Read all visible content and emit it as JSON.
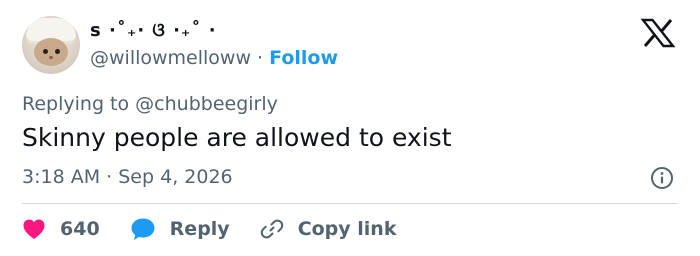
{
  "author": {
    "display_name": "s ·˚₊· ଓ ·₊˚ ·",
    "handle": "@willowmelloww",
    "separator": "·",
    "follow_label": "Follow"
  },
  "reply_context": {
    "prefix": "Replying to",
    "mention": "@chubbeegirly"
  },
  "tweet": {
    "text": "Skinny people are allowed to exist",
    "time": "3:18 AM",
    "separator": "·",
    "date": "Sep 4, 2026"
  },
  "actions": {
    "like_count": "640",
    "reply_label": "Reply",
    "copy_link_label": "Copy link"
  },
  "colors": {
    "accent": "#1d9bf0",
    "like": "#f91880",
    "secondary_text": "#536471",
    "primary_text": "#0f1419"
  },
  "icons": [
    "x-logo-icon",
    "info-icon",
    "heart-icon",
    "reply-bubble-icon",
    "link-icon"
  ]
}
